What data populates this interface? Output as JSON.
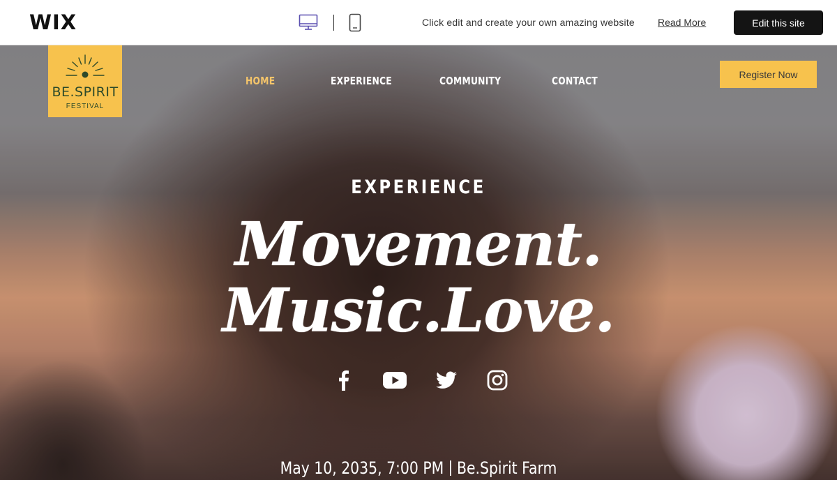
{
  "wix_bar": {
    "logo": "WIX",
    "desktop_view_icon": "desktop-icon",
    "mobile_view_icon": "mobile-icon",
    "message": "Click edit and create your own amazing website",
    "read_more": "Read More",
    "edit_button": "Edit this site",
    "colors": {
      "button_bg": "#141414",
      "desktop_icon": "#5a4fb0"
    }
  },
  "site": {
    "brand": {
      "name": "BE.SPIRIT",
      "subtitle": "FESTIVAL",
      "icon": "sun-icon",
      "color": "#f7c24d"
    },
    "nav": [
      {
        "label": "HOME",
        "active": true
      },
      {
        "label": "EXPERIENCE",
        "active": false
      },
      {
        "label": "COMMUNITY",
        "active": false
      },
      {
        "label": "CONTACT",
        "active": false
      }
    ],
    "register_button": "Register Now",
    "hero": {
      "kicker": "EXPERIENCE",
      "line1": "Movement.",
      "line2": "Music.Love."
    },
    "social": [
      "facebook-icon",
      "youtube-icon",
      "twitter-icon",
      "instagram-icon"
    ],
    "event": {
      "date": "May 10, 2035, 7:00 PM",
      "venue": "Be.Spirit Farm"
    }
  }
}
